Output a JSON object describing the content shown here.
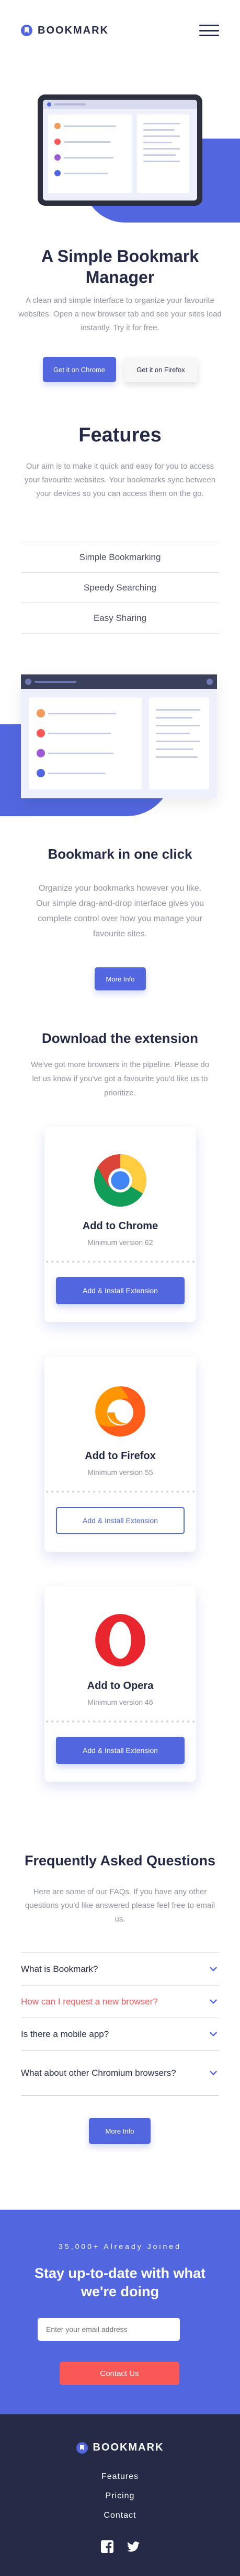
{
  "brand": {
    "name": "BOOKMARK",
    "accent": "#5267df",
    "red": "#fa5757",
    "dark": "#252b46"
  },
  "header": {
    "menu_icon": "hamburger-icon"
  },
  "hero": {
    "title": "A Simple Bookmark Manager",
    "text": "A clean and simple interface to organize your favourite websites. Open a new browser tab and see your sites load instantly. Try it for free.",
    "chrome_button": "Get it on Chrome",
    "firefox_button": "Get it on Firefox"
  },
  "features": {
    "title": "Features",
    "text": "Our aim is to make it quick and easy for you to access your favourite websites. Your bookmarks sync between your devices so you can access them on the go.",
    "tabs": [
      "Simple Bookmarking",
      "Speedy Searching",
      "Easy Sharing"
    ],
    "detail_title": "Bookmark in one click",
    "detail_text": "Organize your bookmarks however you like. Our simple drag-and-drop interface gives you complete control over how you manage your favourite sites.",
    "more_info": "More Info"
  },
  "extensions": {
    "title": "Download the extension",
    "text": "We've got more browsers in the pipeline. Please do let us know if you've got a favourite you'd like us to prioritize.",
    "cards": [
      {
        "name": "Add to Chrome",
        "version": "Minimum version 62",
        "button": "Add & Install Extension",
        "icon": "chrome-icon"
      },
      {
        "name": "Add to Firefox",
        "version": "Minimum version 55",
        "button": "Add & Install Extension",
        "icon": "firefox-icon"
      },
      {
        "name": "Add to Opera",
        "version": "Minimum version 46",
        "button": "Add & Install Extension",
        "icon": "opera-icon"
      }
    ]
  },
  "faq": {
    "title": "Frequently Asked Questions",
    "text": "Here are some of our FAQs. If you have any other questions you'd like answered please feel free to email us.",
    "questions": [
      "What is Bookmark?",
      "How can I request a new browser?",
      "Is there a mobile app?",
      "What about other Chromium browsers?"
    ],
    "more_info": "More Info"
  },
  "subscribe": {
    "joined": "35,000+ Already Joined",
    "title": "Stay up-to-date with what we're doing",
    "placeholder": "Enter your email address",
    "button": "Contact Us"
  },
  "footer": {
    "brand": "BOOKMARK",
    "links": [
      "Features",
      "Pricing",
      "Contact"
    ],
    "social": [
      "facebook-icon",
      "twitter-icon"
    ]
  }
}
